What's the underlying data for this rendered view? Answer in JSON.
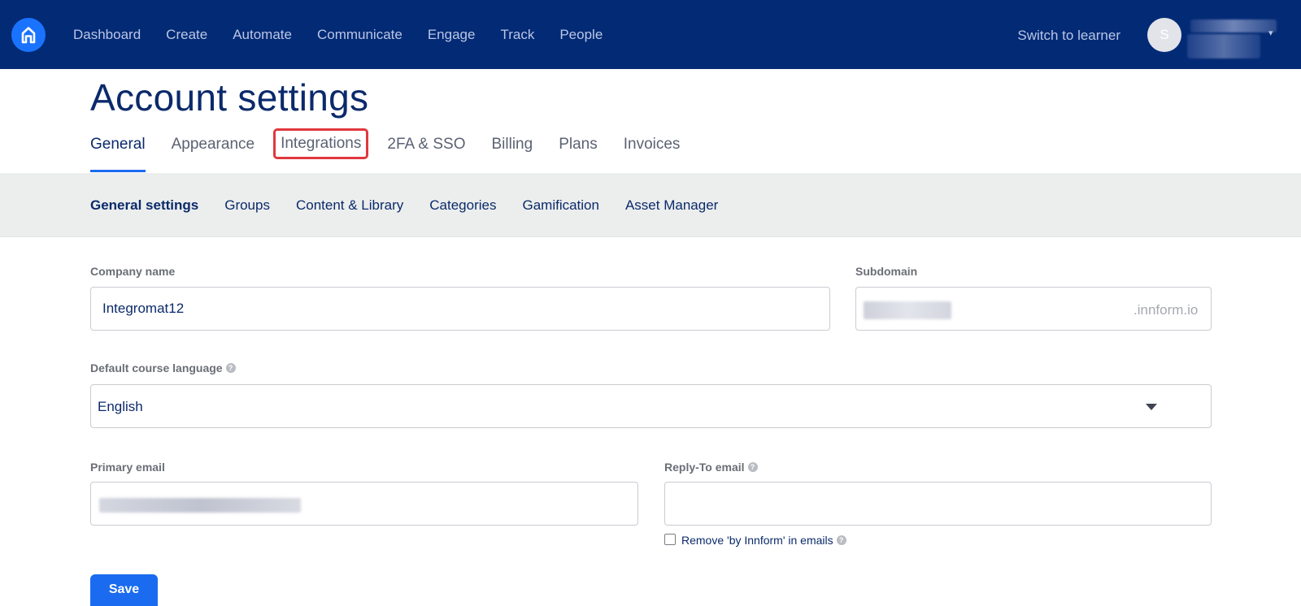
{
  "header": {
    "nav": [
      "Dashboard",
      "Create",
      "Automate",
      "Communicate",
      "Engage",
      "Track",
      "People"
    ],
    "switch_label": "Switch to learner",
    "avatar_initial": "S"
  },
  "page": {
    "title": "Account settings",
    "tabs": [
      "General",
      "Appearance",
      "Integrations",
      "2FA & SSO",
      "Billing",
      "Plans",
      "Invoices"
    ],
    "active_tab": "General",
    "highlighted_tab": "Integrations"
  },
  "subnav": {
    "items": [
      "General settings",
      "Groups",
      "Content & Library",
      "Categories",
      "Gamification",
      "Asset Manager"
    ],
    "active": "General settings"
  },
  "form": {
    "company_name_label": "Company name",
    "company_name_value": "Integromat12",
    "subdomain_label": "Subdomain",
    "subdomain_suffix": ".innform.io",
    "language_label": "Default course language",
    "language_value": "English",
    "primary_email_label": "Primary email",
    "reply_to_label": "Reply-To email",
    "reply_to_value": "",
    "remove_branding_label": "Remove 'by Innform' in emails",
    "remove_branding_checked": false,
    "save_label": "Save",
    "help_glyph": "?"
  },
  "colors": {
    "topbar": "#032a75",
    "accent": "#1a6bf0",
    "highlight": "#e0383e",
    "subnav_bg": "#eceeed"
  }
}
